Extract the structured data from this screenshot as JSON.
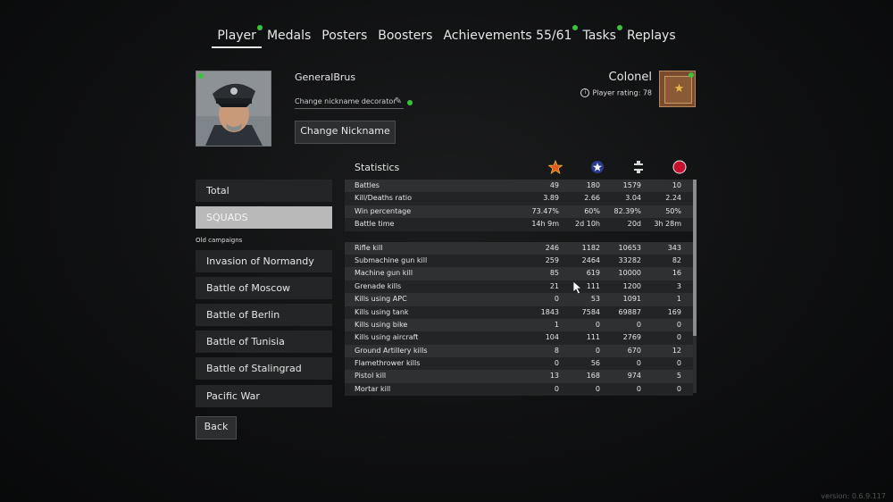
{
  "nav": {
    "tabs": [
      {
        "label": "Player",
        "active": true,
        "badge": true
      },
      {
        "label": "Medals",
        "active": false,
        "badge": false
      },
      {
        "label": "Posters",
        "active": false,
        "badge": false
      },
      {
        "label": "Boosters",
        "active": false,
        "badge": false
      },
      {
        "label": "Achievements 55/61",
        "active": false,
        "badge": true
      },
      {
        "label": "Tasks",
        "active": false,
        "badge": true
      },
      {
        "label": "Replays",
        "active": false,
        "badge": false
      }
    ]
  },
  "profile": {
    "nickname": "GeneralBrus",
    "decorator_label": "Change nickname decorator",
    "change_nickname_button": "Change Nickname",
    "rank": "Colonel",
    "rating_label": "Player rating: 78"
  },
  "sidebar": {
    "total": "Total",
    "squads": "SQUADS",
    "old_campaigns_label": "Old campaigns",
    "campaigns": [
      "Invasion of Normandy",
      "Battle of Moscow",
      "Battle of Berlin",
      "Battle of Tunisia",
      "Battle of Stalingrad",
      "Pacific War"
    ],
    "back_button": "Back"
  },
  "stats": {
    "title": "Statistics",
    "faction_icons": [
      "ussr-star-icon",
      "usa-star-icon",
      "germany-cross-icon",
      "japan-sun-icon"
    ],
    "summary_rows": [
      {
        "label": "Battles",
        "values": [
          "49",
          "180",
          "1579",
          "10"
        ]
      },
      {
        "label": "Kill/Deaths ratio",
        "values": [
          "3.89",
          "2.66",
          "3.04",
          "2.24"
        ]
      },
      {
        "label": "Win percentage",
        "values": [
          "73.47%",
          "60%",
          "82.39%",
          "50%"
        ]
      },
      {
        "label": "Battle time",
        "values": [
          "14h 9m",
          "2d 10h",
          "20d",
          "3h 28m"
        ]
      }
    ],
    "kill_rows": [
      {
        "label": "Rifle kill",
        "values": [
          "246",
          "1182",
          "10653",
          "343"
        ]
      },
      {
        "label": "Submachine gun kill",
        "values": [
          "259",
          "2464",
          "33282",
          "82"
        ]
      },
      {
        "label": "Machine gun kill",
        "values": [
          "85",
          "619",
          "10000",
          "16"
        ]
      },
      {
        "label": "Grenade kills",
        "values": [
          "21",
          "111",
          "1200",
          "3"
        ]
      },
      {
        "label": "Kills using APC",
        "values": [
          "0",
          "53",
          "1091",
          "1"
        ]
      },
      {
        "label": "Kills using tank",
        "values": [
          "1843",
          "7584",
          "69887",
          "169"
        ]
      },
      {
        "label": "Kills using bike",
        "values": [
          "1",
          "0",
          "0",
          "0"
        ]
      },
      {
        "label": "Kills using aircraft",
        "values": [
          "104",
          "111",
          "2769",
          "0"
        ]
      },
      {
        "label": "Ground Artillery kills",
        "values": [
          "8",
          "0",
          "670",
          "12"
        ]
      },
      {
        "label": "Flamethrower kills",
        "values": [
          "0",
          "56",
          "0",
          "0"
        ]
      },
      {
        "label": "Pistol kill",
        "values": [
          "13",
          "168",
          "974",
          "5"
        ]
      },
      {
        "label": "Mortar kill",
        "values": [
          "0",
          "0",
          "0",
          "0"
        ]
      }
    ]
  },
  "version": "version: 0.6.9.117",
  "colors": {
    "badge_green": "#3ac43a",
    "selected_bg": "#b9b9b9"
  }
}
